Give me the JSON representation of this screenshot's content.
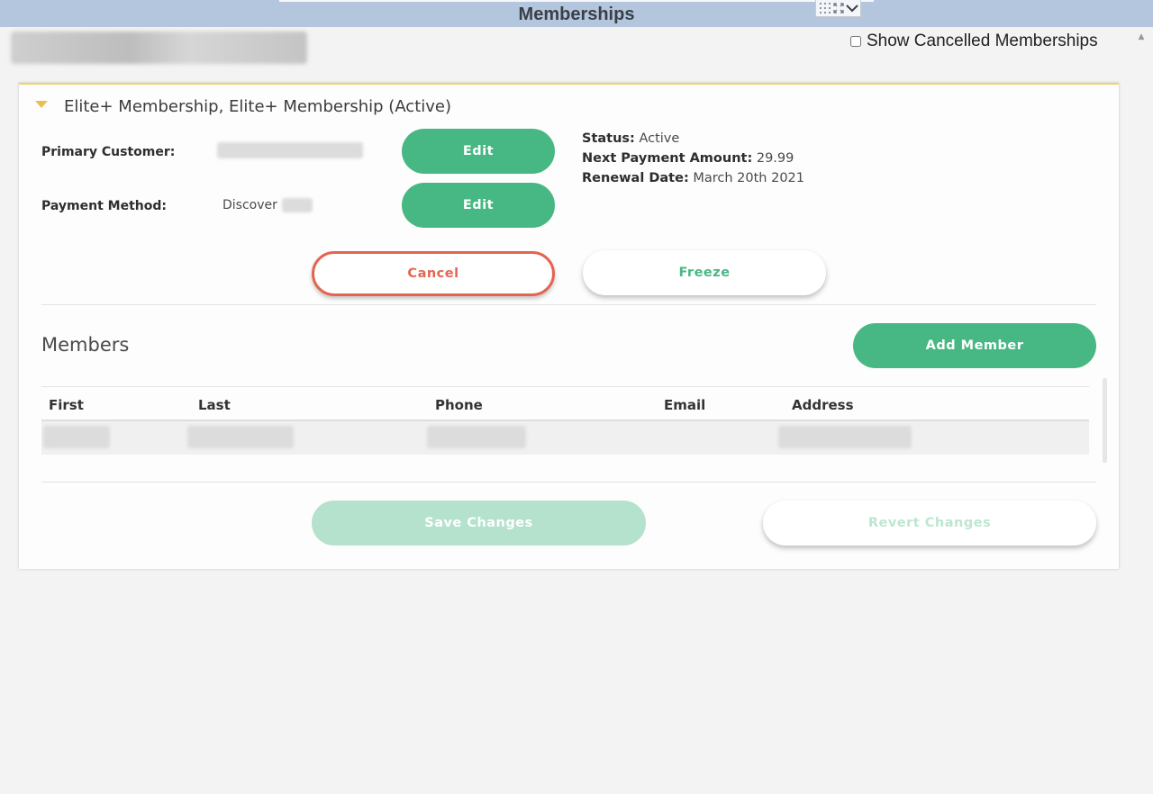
{
  "window": {
    "title": "Memberships",
    "tools": [
      "grid-icon",
      "expand-icon",
      "chevron-down-icon"
    ]
  },
  "filter": {
    "show_cancelled_label": "Show Cancelled Memberships",
    "show_cancelled_checked": false
  },
  "membership": {
    "header": "Elite+ Membership, Elite+ Membership (Active)",
    "primary_customer_label": "Primary Customer:",
    "payment_method_label": "Payment Method:",
    "payment_method_value": "Discover",
    "edit_label": "Edit",
    "status_label": "Status:",
    "status_value": "Active",
    "next_payment_label": "Next Payment Amount:",
    "next_payment_value": "29.99",
    "renewal_label": "Renewal Date:",
    "renewal_value": "March 20th 2021",
    "cancel_label": "Cancel",
    "freeze_label": "Freeze"
  },
  "members": {
    "title": "Members",
    "add_label": "Add Member",
    "columns": [
      "First",
      "Last",
      "Phone",
      "Email",
      "Address"
    ]
  },
  "footer": {
    "save_label": "Save Changes",
    "revert_label": "Revert Changes"
  },
  "colors": {
    "accent_green": "#47b883",
    "cancel_red": "#e4654f",
    "header_accent": "#f0d26a",
    "titlebar": "#b3c6dd"
  }
}
